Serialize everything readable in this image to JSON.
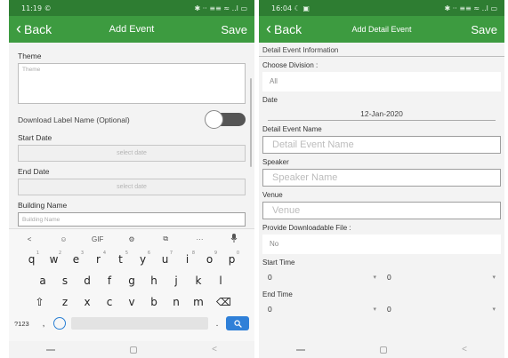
{
  "left": {
    "status": {
      "time": "11:19",
      "left_icons": "©",
      "right_icons": "✱ ·· ≡≡ ≈ ..l ▭"
    },
    "app_bar": {
      "back_label": "Back",
      "title": "Add Event",
      "save_label": "Save"
    },
    "theme": {
      "label": "Theme",
      "placeholder": "Theme"
    },
    "download_toggle": {
      "label": "Download Label Name (Optional)",
      "state": "off"
    },
    "start_date": {
      "label": "Start Date",
      "placeholder": "select date"
    },
    "end_date": {
      "label": "End Date",
      "placeholder": "select date"
    },
    "building": {
      "label": "Building Name",
      "placeholder": "Building Name"
    },
    "keyboard": {
      "toolbar": [
        "<",
        "☺",
        "GIF",
        "⚙",
        "⧉",
        "···",
        "↓"
      ],
      "row1": [
        {
          "key": "q",
          "hint": "1"
        },
        {
          "key": "w",
          "hint": "2"
        },
        {
          "key": "e",
          "hint": "3"
        },
        {
          "key": "r",
          "hint": "4"
        },
        {
          "key": "t",
          "hint": "5"
        },
        {
          "key": "y",
          "hint": "6"
        },
        {
          "key": "u",
          "hint": "7"
        },
        {
          "key": "i",
          "hint": "8"
        },
        {
          "key": "o",
          "hint": "9"
        },
        {
          "key": "p",
          "hint": "0"
        }
      ],
      "row2": [
        "a",
        "s",
        "d",
        "f",
        "g",
        "h",
        "j",
        "k",
        "l"
      ],
      "row3": [
        "⇧",
        "z",
        "x",
        "c",
        "v",
        "b",
        "n",
        "m",
        "⌫"
      ],
      "numbers_key": "?123",
      "comma_key": ",",
      "period_key": "."
    }
  },
  "right": {
    "status": {
      "time": "16:04",
      "left_icons": "☾ ▣",
      "right_icons": "✱ ·· ≡≡ ≈ ..l ▭"
    },
    "app_bar": {
      "back_label": "Back",
      "title": "Add Detail Event",
      "save_label": "Save"
    },
    "section_title": "Detail Event Information",
    "division": {
      "label": "Choose Division :",
      "value": "All"
    },
    "date": {
      "label": "Date",
      "value": "12-Jan-2020"
    },
    "event_name": {
      "label": "Detail Event Name",
      "placeholder": "Detail Event Name"
    },
    "speaker": {
      "label": "Speaker",
      "placeholder": "Speaker Name"
    },
    "venue": {
      "label": "Venue",
      "placeholder": "Venue"
    },
    "downloadable": {
      "label": "Provide Downloadable File :",
      "value": "No"
    },
    "start_time": {
      "label": "Start Time",
      "hour": "0",
      "minute": "0"
    },
    "end_time": {
      "label": "End Time",
      "hour": "0",
      "minute": "0"
    }
  },
  "colors": {
    "status_bar": "#2e7d32",
    "app_bar": "#3d9b40",
    "keyboard_action": "#2f80d8"
  },
  "icons": [
    "chevron-left-icon",
    "settings-icon",
    "clipboard-icon",
    "mic-icon",
    "emoji-icon",
    "search-icon",
    "shift-icon",
    "backspace-icon",
    "caret-down-icon"
  ]
}
